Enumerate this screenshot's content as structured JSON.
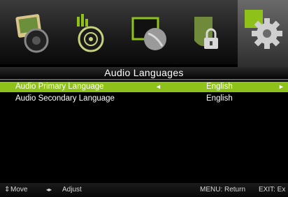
{
  "menu": {
    "categories": [
      {
        "icon": "picture-icon"
      },
      {
        "icon": "sound-icon"
      },
      {
        "icon": "channel-icon"
      },
      {
        "icon": "lock-icon"
      },
      {
        "icon": "setup-gear-icon",
        "active": true
      }
    ]
  },
  "page": {
    "title": "Audio Languages"
  },
  "options": [
    {
      "label": "Audio Primary Language",
      "value": "English",
      "left_arrow": "◄",
      "right_arrow": "►"
    },
    {
      "label": "Audio Secondary Language",
      "value": "English"
    }
  ],
  "footer": {
    "move_icon": "⇕",
    "move_label": "Move",
    "adjust_icon": "◂▸",
    "adjust_label": "Adjust",
    "menu_hint": "MENU: Return",
    "exit_hint": "EXIT: Ex"
  },
  "colors": {
    "highlight": "#8ec21a",
    "background": "#000000"
  }
}
